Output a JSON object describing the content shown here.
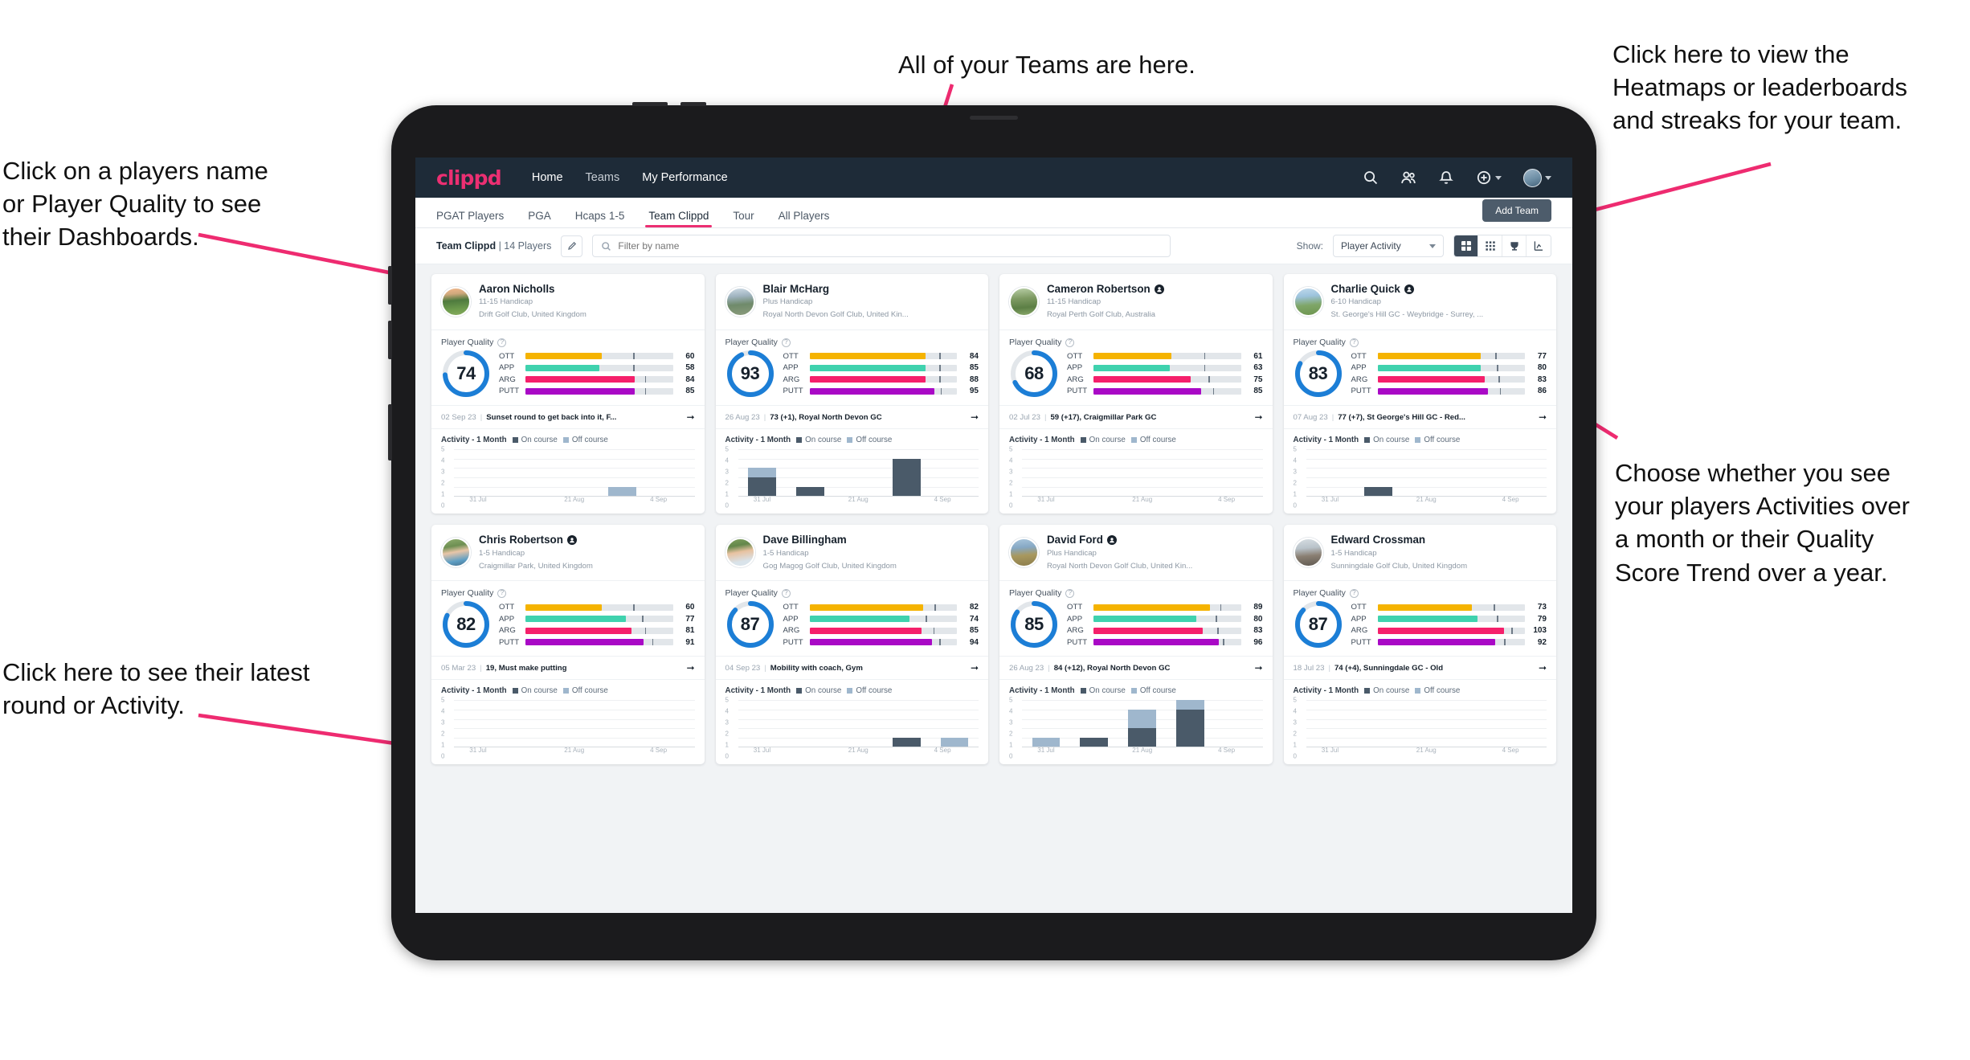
{
  "annotations": [
    {
      "id": "teams",
      "text": "All of your Teams are here."
    },
    {
      "id": "heatmaps",
      "text": "Click here to view the\nHeatmaps or leaderboards\nand streaks for your team."
    },
    {
      "id": "players-name",
      "text": "Click on a players name\nor Player Quality to see\ntheir Dashboards."
    },
    {
      "id": "activity-choice",
      "text": "Choose whether you see\nyour players Activities over\na month or their Quality\nScore Trend over a year."
    },
    {
      "id": "latest-round",
      "text": "Click here to see their latest\nround or Activity."
    }
  ],
  "navbar": {
    "logo": "clippd",
    "links": [
      {
        "label": "Home",
        "active": true
      },
      {
        "label": "Teams",
        "active": false
      },
      {
        "label": "My Performance",
        "active": false
      }
    ],
    "icons": [
      "search-icon",
      "people-icon",
      "bell-icon",
      "plus-circle-icon",
      "avatar"
    ]
  },
  "subnav": {
    "tabs": [
      {
        "label": "PGAT Players",
        "active": false
      },
      {
        "label": "PGA",
        "active": false
      },
      {
        "label": "Hcaps 1-5",
        "active": false
      },
      {
        "label": "Team Clippd",
        "active": true
      },
      {
        "label": "Tour",
        "active": false
      },
      {
        "label": "All Players",
        "active": false
      }
    ],
    "add_team_label": "Add Team"
  },
  "toolbar": {
    "team_name": "Team Clippd",
    "team_count": "| 14 Players",
    "edit_icon": "pencil-icon",
    "search_placeholder": "Filter by name",
    "show_label": "Show:",
    "show_value": "Player Activity",
    "view_buttons": [
      {
        "icon": "grid-large-icon",
        "active": true
      },
      {
        "icon": "grid-dots-icon",
        "active": false
      },
      {
        "icon": "trophy-icon",
        "active": false
      },
      {
        "icon": "chart-icon",
        "active": false
      }
    ]
  },
  "quality_metrics": [
    "OTT",
    "APP",
    "ARG",
    "PUTT"
  ],
  "metric_colors": {
    "OTT": "#f5b300",
    "APP": "#3fd2ae",
    "ARG": "#f5206b",
    "PUTT": "#a909c6"
  },
  "activity": {
    "title": "Activity - 1 Month",
    "legend_on": "On course",
    "legend_off": "Off course",
    "y_ticks": [
      5,
      4,
      3,
      2,
      1,
      0
    ],
    "x_ticks": [
      "31 Jul",
      "21 Aug",
      "4 Sep"
    ]
  },
  "quality_section_label": "Player Quality",
  "cards": [
    {
      "name": "Aaron Nicholls",
      "verified": false,
      "handicap": "11-15 Handicap",
      "club": "Drift Golf Club, United Kingdom",
      "score": 74,
      "bars": [
        {
          "label": "OTT",
          "value": 60,
          "fill": 52,
          "tick": 73
        },
        {
          "label": "APP",
          "value": 58,
          "fill": 50,
          "tick": 73
        },
        {
          "label": "ARG",
          "value": 84,
          "fill": 74,
          "tick": 81
        },
        {
          "label": "PUTT",
          "value": 85,
          "fill": 74,
          "tick": 81
        }
      ],
      "round_date": "02 Sep 23",
      "round_text": "Sunset round to get back into it, F...",
      "chart_data": {
        "type": "bar",
        "title": "Activity - 1 Month",
        "categories": [
          "31 Jul",
          "",
          "",
          "21 Aug",
          "4 Sep"
        ],
        "series": [
          {
            "name": "On course",
            "values": [
              0,
              0,
              0,
              0,
              0
            ]
          },
          {
            "name": "Off course",
            "values": [
              0,
              0,
              0,
              1,
              0
            ]
          }
        ],
        "ylim": [
          0,
          5
        ]
      }
    },
    {
      "name": "Blair McHarg",
      "verified": false,
      "handicap": "Plus Handicap",
      "club": "Royal North Devon Golf Club, United Kin...",
      "score": 93,
      "bars": [
        {
          "label": "OTT",
          "value": 84,
          "fill": 79,
          "tick": 88
        },
        {
          "label": "APP",
          "value": 85,
          "fill": 79,
          "tick": 88
        },
        {
          "label": "ARG",
          "value": 88,
          "fill": 79,
          "tick": 88
        },
        {
          "label": "PUTT",
          "value": 95,
          "fill": 85,
          "tick": 89
        }
      ],
      "round_date": "26 Aug 23",
      "round_text": "73 (+1), Royal North Devon GC",
      "chart_data": {
        "type": "bar",
        "title": "Activity - 1 Month",
        "categories": [
          "31 Jul",
          "",
          "",
          "21 Aug",
          "4 Sep"
        ],
        "series": [
          {
            "name": "On course",
            "values": [
              2,
              1,
              0,
              4,
              0
            ]
          },
          {
            "name": "Off course",
            "values": [
              1,
              0,
              0,
              0,
              0
            ]
          }
        ],
        "ylim": [
          0,
          5
        ]
      }
    },
    {
      "name": "Cameron Robertson",
      "verified": true,
      "handicap": "11-15 Handicap",
      "club": "Royal Perth Golf Club, Australia",
      "score": 68,
      "bars": [
        {
          "label": "OTT",
          "value": 61,
          "fill": 53,
          "tick": 75
        },
        {
          "label": "APP",
          "value": 63,
          "fill": 52,
          "tick": 75
        },
        {
          "label": "ARG",
          "value": 75,
          "fill": 66,
          "tick": 78
        },
        {
          "label": "PUTT",
          "value": 85,
          "fill": 73,
          "tick": 81
        }
      ],
      "round_date": "02 Jul 23",
      "round_text": "59 (+17), Craigmillar Park GC",
      "chart_data": {
        "type": "bar",
        "title": "Activity - 1 Month",
        "categories": [
          "31 Jul",
          "",
          "",
          "21 Aug",
          "4 Sep"
        ],
        "series": [
          {
            "name": "On course",
            "values": [
              0,
              0,
              0,
              0,
              0
            ]
          },
          {
            "name": "Off course",
            "values": [
              0,
              0,
              0,
              0,
              0
            ]
          }
        ],
        "ylim": [
          0,
          5
        ]
      }
    },
    {
      "name": "Charlie Quick",
      "verified": true,
      "handicap": "6-10 Handicap",
      "club": "St. George's Hill GC - Weybridge - Surrey, ...",
      "score": 83,
      "bars": [
        {
          "label": "OTT",
          "value": 77,
          "fill": 70,
          "tick": 80
        },
        {
          "label": "APP",
          "value": 80,
          "fill": 70,
          "tick": 81
        },
        {
          "label": "ARG",
          "value": 83,
          "fill": 73,
          "tick": 82
        },
        {
          "label": "PUTT",
          "value": 86,
          "fill": 75,
          "tick": 83
        }
      ],
      "round_date": "07 Aug 23",
      "round_text": "77 (+7), St George's Hill GC - Red...",
      "chart_data": {
        "type": "bar",
        "title": "Activity - 1 Month",
        "categories": [
          "31 Jul",
          "",
          "",
          "21 Aug",
          "4 Sep"
        ],
        "series": [
          {
            "name": "On course",
            "values": [
              0,
              1,
              0,
              0,
              0
            ]
          },
          {
            "name": "Off course",
            "values": [
              0,
              0,
              0,
              0,
              0
            ]
          }
        ],
        "ylim": [
          0,
          5
        ]
      }
    },
    {
      "name": "Chris Robertson",
      "verified": true,
      "handicap": "1-5 Handicap",
      "club": "Craigmillar Park, United Kingdom",
      "score": 82,
      "bars": [
        {
          "label": "OTT",
          "value": 60,
          "fill": 52,
          "tick": 73
        },
        {
          "label": "APP",
          "value": 77,
          "fill": 68,
          "tick": 79
        },
        {
          "label": "ARG",
          "value": 81,
          "fill": 72,
          "tick": 81
        },
        {
          "label": "PUTT",
          "value": 91,
          "fill": 80,
          "tick": 86
        }
      ],
      "round_date": "05 Mar 23",
      "round_text": "19, Must make putting",
      "chart_data": {
        "type": "bar",
        "title": "Activity - 1 Month",
        "categories": [
          "31 Jul",
          "",
          "",
          "21 Aug",
          "4 Sep"
        ],
        "series": [
          {
            "name": "On course",
            "values": [
              0,
              0,
              0,
              0,
              0
            ]
          },
          {
            "name": "Off course",
            "values": [
              0,
              0,
              0,
              0,
              0
            ]
          }
        ],
        "ylim": [
          0,
          5
        ]
      }
    },
    {
      "name": "Dave Billingham",
      "verified": false,
      "handicap": "1-5 Handicap",
      "club": "Gog Magog Golf Club, United Kingdom",
      "score": 87,
      "bars": [
        {
          "label": "OTT",
          "value": 82,
          "fill": 77,
          "tick": 85
        },
        {
          "label": "APP",
          "value": 74,
          "fill": 68,
          "tick": 79
        },
        {
          "label": "ARG",
          "value": 85,
          "fill": 76,
          "tick": 84
        },
        {
          "label": "PUTT",
          "value": 94,
          "fill": 83,
          "tick": 88
        }
      ],
      "round_date": "04 Sep 23",
      "round_text": "Mobility with coach, Gym",
      "chart_data": {
        "type": "bar",
        "title": "Activity - 1 Month",
        "categories": [
          "31 Jul",
          "",
          "",
          "21 Aug",
          "4 Sep"
        ],
        "series": [
          {
            "name": "On course",
            "values": [
              0,
              0,
              0,
              1,
              0
            ]
          },
          {
            "name": "Off course",
            "values": [
              0,
              0,
              0,
              0,
              1
            ]
          }
        ],
        "ylim": [
          0,
          5
        ]
      }
    },
    {
      "name": "David Ford",
      "verified": true,
      "handicap": "Plus Handicap",
      "club": "Royal North Devon Golf Club, United Kin...",
      "score": 85,
      "bars": [
        {
          "label": "OTT",
          "value": 89,
          "fill": 79,
          "tick": 86
        },
        {
          "label": "APP",
          "value": 80,
          "fill": 70,
          "tick": 83
        },
        {
          "label": "ARG",
          "value": 83,
          "fill": 74,
          "tick": 84
        },
        {
          "label": "PUTT",
          "value": 96,
          "fill": 85,
          "tick": 88
        }
      ],
      "round_date": "26 Aug 23",
      "round_text": "84 (+12), Royal North Devon GC",
      "chart_data": {
        "type": "bar",
        "title": "Activity - 1 Month",
        "categories": [
          "31 Jul",
          "",
          "",
          "21 Aug",
          "4 Sep"
        ],
        "series": [
          {
            "name": "On course",
            "values": [
              0,
              1,
              2,
              4,
              0
            ]
          },
          {
            "name": "Off course",
            "values": [
              1,
              0,
              2,
              1,
              0
            ]
          }
        ],
        "ylim": [
          0,
          5
        ]
      }
    },
    {
      "name": "Edward Crossman",
      "verified": false,
      "handicap": "1-5 Handicap",
      "club": "Sunningdale Golf Club, United Kingdom",
      "score": 87,
      "bars": [
        {
          "label": "OTT",
          "value": 73,
          "fill": 64,
          "tick": 79
        },
        {
          "label": "APP",
          "value": 79,
          "fill": 68,
          "tick": 81
        },
        {
          "label": "ARG",
          "value": 103,
          "fill": 86,
          "tick": 91
        },
        {
          "label": "PUTT",
          "value": 92,
          "fill": 80,
          "tick": 86
        }
      ],
      "round_date": "18 Jul 23",
      "round_text": "74 (+4), Sunningdale GC - Old",
      "chart_data": {
        "type": "bar",
        "title": "Activity - 1 Month",
        "categories": [
          "31 Jul",
          "",
          "",
          "21 Aug",
          "4 Sep"
        ],
        "series": [
          {
            "name": "On course",
            "values": [
              0,
              0,
              0,
              0,
              0
            ]
          },
          {
            "name": "Off course",
            "values": [
              0,
              0,
              0,
              0,
              0
            ]
          }
        ],
        "ylim": [
          0,
          5
        ]
      }
    }
  ]
}
